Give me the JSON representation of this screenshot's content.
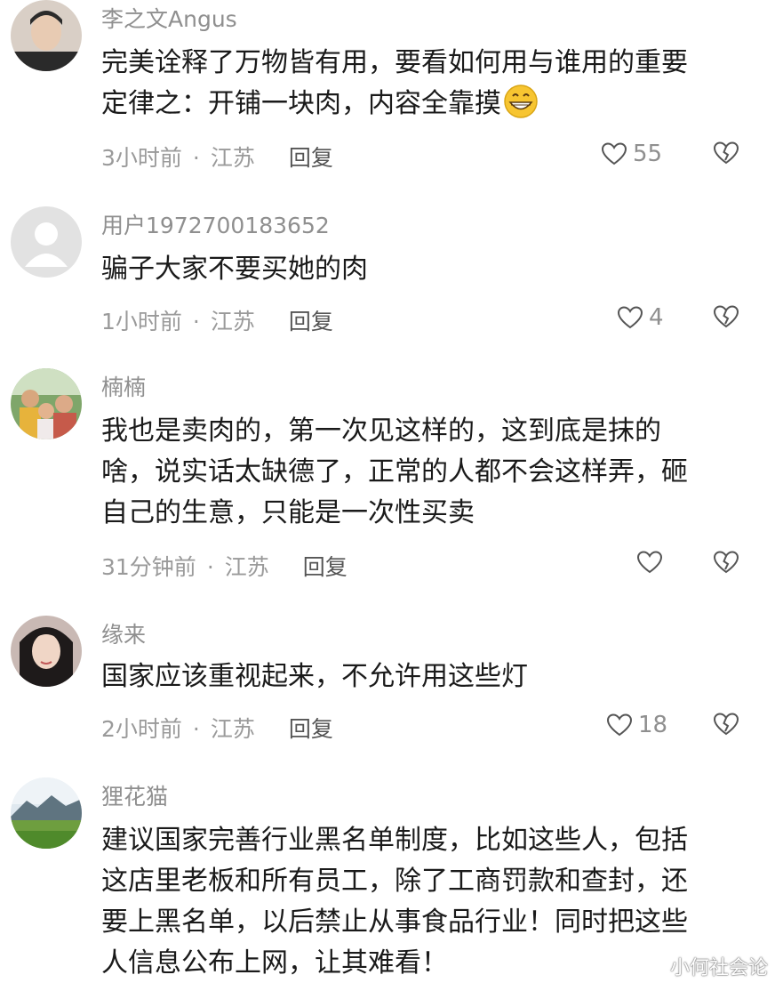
{
  "comments": [
    {
      "username": "李之文Angus",
      "lines": [
        "完美诠释了万物皆有用，要看如何用与谁用的重要",
        "定律之：开铺一块肉，内容全靠摸"
      ],
      "time": "3小时前",
      "location": "江苏",
      "reply": "回复",
      "likes": "55"
    },
    {
      "username": "用户1972700183652",
      "lines": [
        "骗子大家不要买她的肉"
      ],
      "time": "1小时前",
      "location": "江苏",
      "reply": "回复",
      "likes": "4"
    },
    {
      "username": "楠楠",
      "lines": [
        "我也是卖肉的，第一次见这样的，这到底是抹的",
        "啥，说实话太缺德了，正常的人都不会这样弄，砸",
        "自己的生意，只能是一次性买卖"
      ],
      "time": "31分钟前",
      "location": "江苏",
      "reply": "回复",
      "likes": ""
    },
    {
      "username": "缘来",
      "lines": [
        "国家应该重视起来，不允许用这些灯"
      ],
      "time": "2小时前",
      "location": "江苏",
      "reply": "回复",
      "likes": "18"
    },
    {
      "username": "狸花猫",
      "lines": [
        "建议国家完善行业黑名单制度，比如这些人，包括",
        "这店里老板和所有员工，除了工商罚款和查封，还",
        "要上黑名单，以后禁止从事食品行业！同时把这些",
        "人信息公布上网，让其难看！"
      ]
    }
  ],
  "separator": "·",
  "emoji": "grinning-face-icon",
  "watermark": "小何社会论",
  "icons": {
    "like": "heart-outline-icon",
    "dislike": "broken-heart-icon"
  },
  "colors": {
    "meta": "#9a9a9a",
    "username": "#8f8f8f",
    "text": "#1a1a1a",
    "emoji": "#f5c518"
  }
}
